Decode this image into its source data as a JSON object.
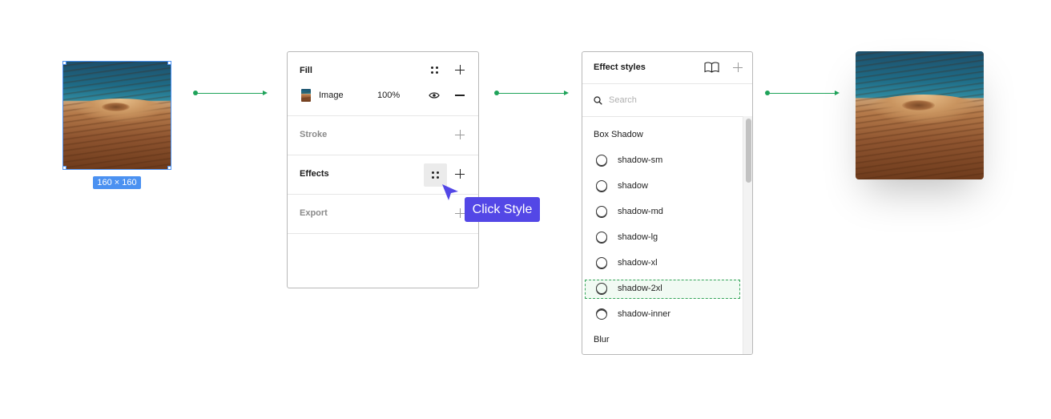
{
  "source_image": {
    "size_badge": "160 × 160"
  },
  "properties_panel": {
    "fill": {
      "title": "Fill",
      "layer_label": "Image",
      "opacity": "100%"
    },
    "stroke": {
      "title": "Stroke"
    },
    "effects": {
      "title": "Effects"
    },
    "export": {
      "title": "Export"
    }
  },
  "tooltip": {
    "label": "Click Style"
  },
  "effect_styles_panel": {
    "title": "Effect styles",
    "search_placeholder": "Search",
    "groups": [
      {
        "name": "Box Shadow",
        "items": [
          "shadow-sm",
          "shadow",
          "shadow-md",
          "shadow-lg",
          "shadow-xl",
          "shadow-2xl",
          "shadow-inner"
        ]
      },
      {
        "name": "Blur",
        "items": []
      }
    ],
    "highlighted_item": "shadow-2xl"
  },
  "colors": {
    "selection_blue": "#4b91f1",
    "flow_arrow_green": "#1fa35a",
    "tooltip_purple": "#5347e6",
    "highlight_green": "#35a55a"
  }
}
